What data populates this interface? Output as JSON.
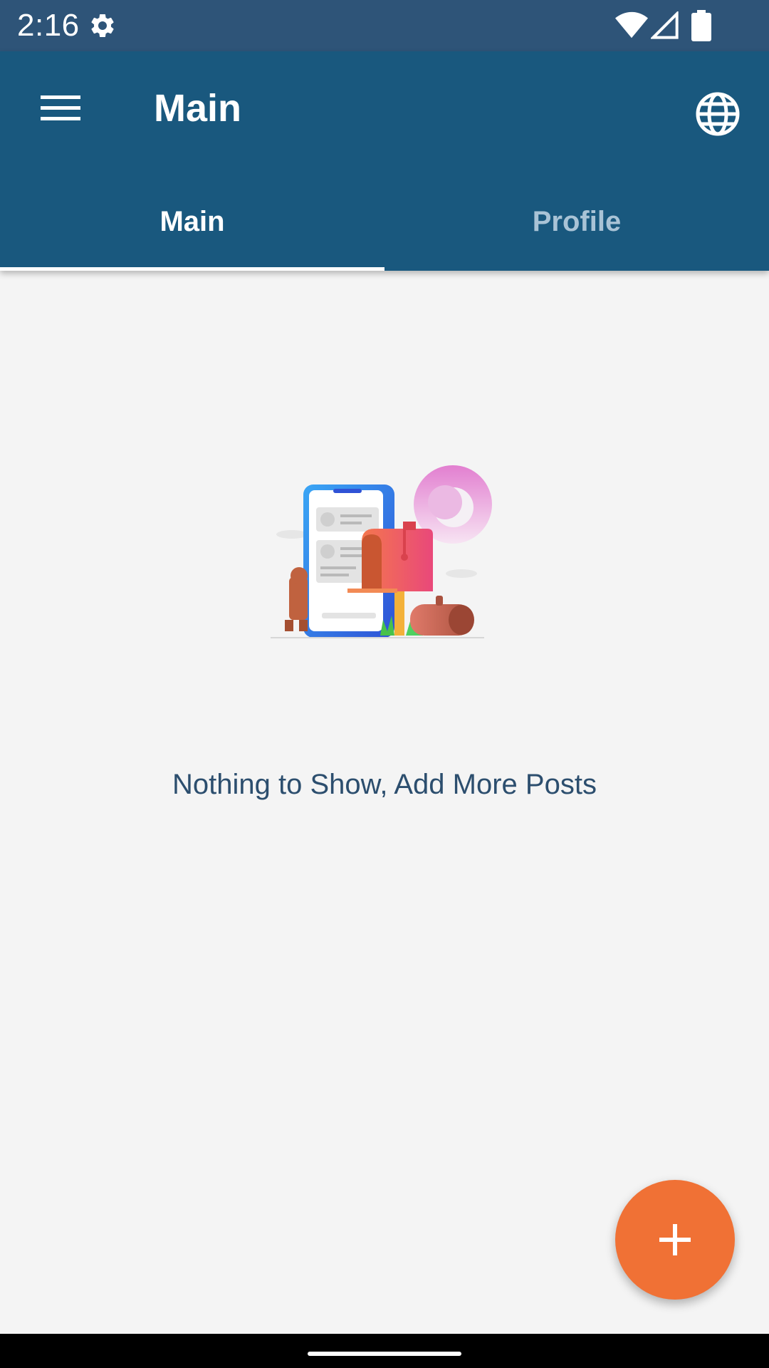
{
  "status_bar": {
    "time": "2:16",
    "icons": [
      "settings-icon",
      "wifi-icon",
      "signal-icon",
      "battery-icon"
    ]
  },
  "app_bar": {
    "title": "Main",
    "menu_icon": "menu-icon",
    "action_icon": "globe-icon"
  },
  "tabs": [
    {
      "label": "Main",
      "selected": true
    },
    {
      "label": "Profile",
      "selected": false
    }
  ],
  "empty_state": {
    "illustration": "empty-mailbox-illustration",
    "message": "Nothing to Show, Add More Posts"
  },
  "fab": {
    "icon": "plus-icon"
  },
  "colors": {
    "status_bar": "#2e5478",
    "app_bar": "#19587e",
    "background": "#f4f4f4",
    "fab": "#f07135",
    "empty_text": "#2c4e6e",
    "tab_inactive": "#a9c3d6"
  }
}
